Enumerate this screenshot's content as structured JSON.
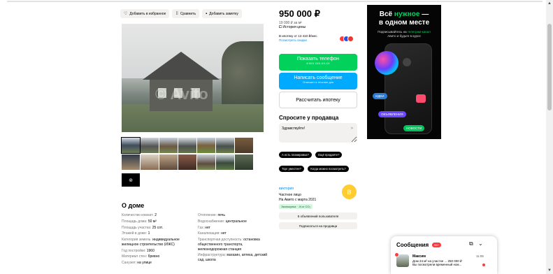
{
  "actions": [
    {
      "icon": "heart-icon",
      "glyph": "♡",
      "label": "Добавить в избранное"
    },
    {
      "icon": "compare-icon",
      "glyph": "⁞⁞",
      "label": "Сравнить"
    },
    {
      "icon": "note-icon",
      "glyph": "▪",
      "label": "Добавить заметку"
    }
  ],
  "photo": {
    "watermark": "© Avito"
  },
  "thumbs_more": "⊚",
  "about": {
    "title": "О доме",
    "left": [
      {
        "k": "Количество комнат:",
        "v": "2"
      },
      {
        "k": "Площадь дома:",
        "v": "50 м²"
      },
      {
        "k": "Площадь участка:",
        "v": "25 сот."
      },
      {
        "k": "Этажей в доме:",
        "v": "1"
      },
      {
        "k": "Категория земель:",
        "v": "индивидуальное жилищное строительство (ИЖС)"
      },
      {
        "k": "Год постройки:",
        "v": "1960"
      },
      {
        "k": "Материал стен:",
        "v": "бревно"
      },
      {
        "k": "Санузел:",
        "v": "на улице"
      }
    ],
    "right": [
      {
        "k": "Отопление:",
        "v": "печь"
      },
      {
        "k": "Водоснабжение:",
        "v": "центральное"
      },
      {
        "k": "Газ:",
        "v": "нет"
      },
      {
        "k": "Канализация:",
        "v": "нет"
      },
      {
        "k": "Транспортная доступность:",
        "v": "остановка общественного транспорта, железнодорожная станция"
      },
      {
        "k": "Инфраструктура:",
        "v": "магазин, аптека, детский сад, школа"
      }
    ]
  },
  "price": {
    "value": "950 000 ₽",
    "per_meter": "19 000 ₽ за м²",
    "history": "История цены",
    "mortgage": "В ипотеку от 13 410 ₽/мес.",
    "mortgage_link": "Посмотреть скидки"
  },
  "buttons": {
    "phone": "Показать телефон",
    "phone_sub": "8 9XX XXX-XX-XX",
    "message": "Написать сообщение",
    "message_sub": "Отвечает в течение дня",
    "calc": "Рассчитать ипотеку"
  },
  "ask": {
    "title": "Спросите у продавца",
    "input_value": "Здравствуйте!",
    "chips": [
      "А есть планировка?",
      "Ещё продаёте?",
      "Торг уместен?",
      "Когда можно посмотреть?"
    ]
  },
  "seller": {
    "name": "виктория",
    "type": "Частное лицо",
    "since": "На Авито с марта 2021",
    "badge": "Экопокупка · -N кг CO₂",
    "avatar_letter": "В",
    "btn_listings": "5 объявлений пользователя",
    "btn_subscribe": "Подписаться на продавца"
  },
  "ad": {
    "headline_1": "Всё",
    "headline_2": "нужное",
    "headline_3": "—",
    "headline_4": "в одном месте",
    "sub_1": "Подписывайтесь на",
    "sub_2": "телеграм-канал",
    "sub_3": "Авито и будьте в курсе",
    "pill_idea": "ИДЕИ",
    "pill_obj": "ОБЪЯВЛЕНИЯ",
    "pill_news": "НОВОСТИ"
  },
  "messages": {
    "title": "Сообщения",
    "badge": "99+",
    "name": "Максим",
    "time": "11:05",
    "line1": "Дом 24 м² на участке ... 250 000 ₽",
    "line2": "Вы посмотрели временный ном..."
  },
  "colors": {
    "accent_green": "#02d15c",
    "accent_blue": "#00aaff",
    "link": "#0a8ee4"
  }
}
